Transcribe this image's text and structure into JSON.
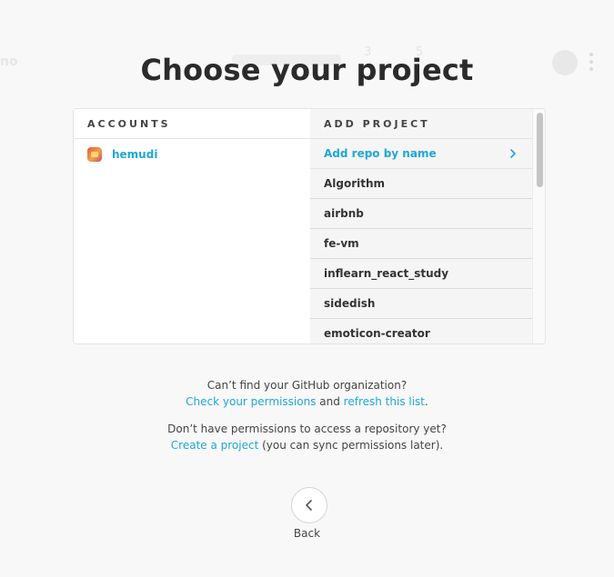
{
  "background": {
    "ghost_left": "no",
    "ghost_n1": "3",
    "ghost_n2": "5"
  },
  "page_title": "Choose your project",
  "accounts": {
    "header": "ACCOUNTS",
    "items": [
      {
        "name": "hemudi"
      }
    ]
  },
  "projects": {
    "header": "ADD PROJECT",
    "add_by_name": "Add repo by name",
    "items": [
      "Algorithm",
      "airbnb",
      "fe-vm",
      "inflearn_react_study",
      "sidedish",
      "emoticon-creator"
    ]
  },
  "help": {
    "line1": "Can’t find your GitHub organization?",
    "check_permissions": "Check your permissions",
    "and": " and ",
    "refresh_list": "refresh this list",
    "period": ".",
    "line3": "Don’t have permissions to access a repository yet?",
    "create_project": "Create a project",
    "sync_note": " (you can sync permissions later)."
  },
  "back_label": "Back",
  "colors": {
    "accent": "#1ea7d8",
    "title": "#2b2b2b",
    "background": "#f8f8f8"
  }
}
